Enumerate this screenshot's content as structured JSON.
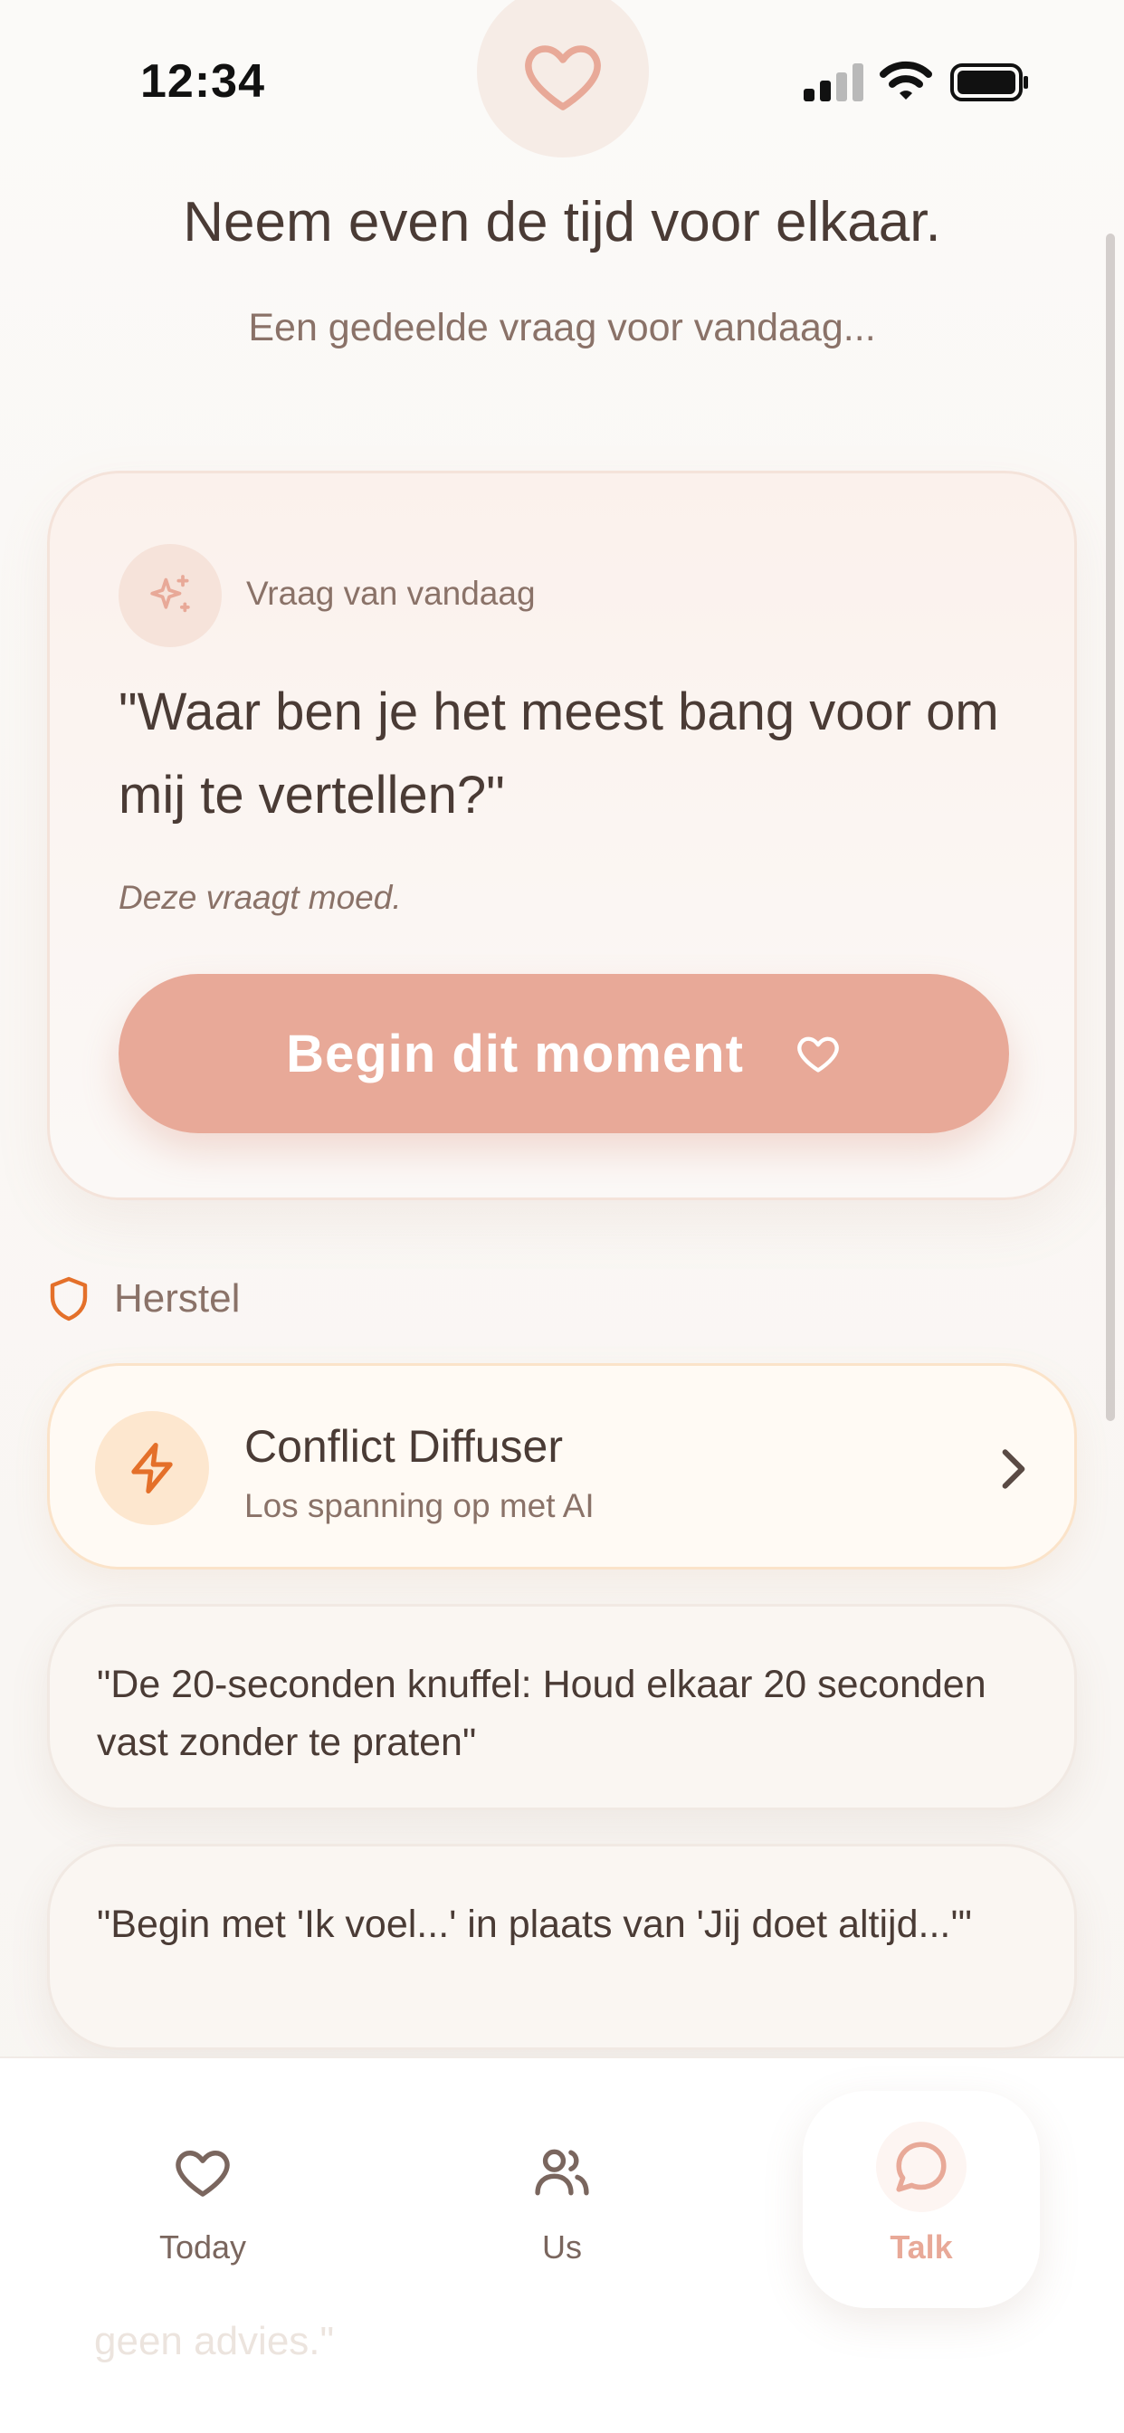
{
  "status_bar": {
    "time": "12:34"
  },
  "header": {
    "title": "Neem even de tijd voor elkaar.",
    "subtitle": "Een gedeelde vraag voor vandaag..."
  },
  "question_card": {
    "label": "Vraag van vandaag",
    "question": "\"Waar ben je het meest bang voor om mij te vertellen?\"",
    "note": "Deze vraagt moed.",
    "button_label": "Begin dit moment"
  },
  "section": {
    "title": "Herstel"
  },
  "diffuser": {
    "title": "Conflict Diffuser",
    "subtitle": "Los spanning op met AI"
  },
  "tips": [
    "\"De 20-seconden knuffel: Houd elkaar 20 seconden vast zonder te praten\"",
    "\"Begin met 'Ik voel...' in plaats van 'Jij doet altijd...'\""
  ],
  "ghost_text": "geen advies.\"",
  "tab_bar": {
    "items": [
      {
        "label": "Today",
        "icon": "heart-icon"
      },
      {
        "label": "Us",
        "icon": "users-icon"
      },
      {
        "label": "Talk",
        "icon": "chat-bubble-icon",
        "active": true
      }
    ]
  },
  "colors": {
    "accent": "#e8a998",
    "accent_orange": "#e4702a",
    "text_primary": "#4a3b35",
    "text_secondary": "#8a7268",
    "background": "#faf8f6"
  }
}
